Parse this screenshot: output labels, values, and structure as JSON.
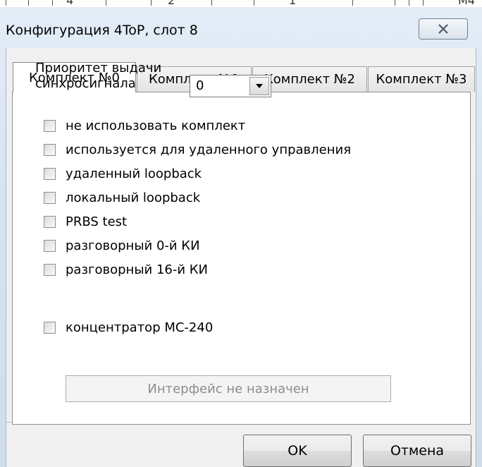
{
  "background_window": {
    "visible_digits": [
      "4",
      "2",
      "1",
      "M4"
    ]
  },
  "window": {
    "title": "Конфигурация 4ToP, слот 8",
    "close_icon": "close-x-icon"
  },
  "tabs": [
    {
      "label": "Комплект №0",
      "active": true
    },
    {
      "label": "Комплект №1",
      "active": false
    },
    {
      "label": "Комплект №2",
      "active": false
    },
    {
      "label": "Комплект №3",
      "active": false
    }
  ],
  "priority": {
    "label_line1": "Приоритет выдачи",
    "label_line2": "синхросигнала",
    "selected_value": "0",
    "dropdown_icon": "chevron-down-icon"
  },
  "checkboxes": [
    {
      "label": "не использовать комплект",
      "checked": false
    },
    {
      "label": "используется для удаленного управления",
      "checked": false
    },
    {
      "label": "удаленный loopback",
      "checked": false
    },
    {
      "label": "локальный loopback",
      "checked": false
    },
    {
      "label": "PRBS test",
      "checked": false
    },
    {
      "label": "разговорный 0-й КИ",
      "checked": false
    },
    {
      "label": "разговорный 16-й КИ",
      "checked": false
    }
  ],
  "concentrator": {
    "label": "концентратор МС-240",
    "checked": false
  },
  "interface_button": {
    "label": "Интерфейс не назначен",
    "enabled": false
  },
  "buttons": {
    "ok": "OK",
    "cancel": "Отмена"
  },
  "colors": {
    "title_bar": "#dbe7f3",
    "panel": "#ffffff",
    "disabled_text": "#8d8d8d"
  }
}
